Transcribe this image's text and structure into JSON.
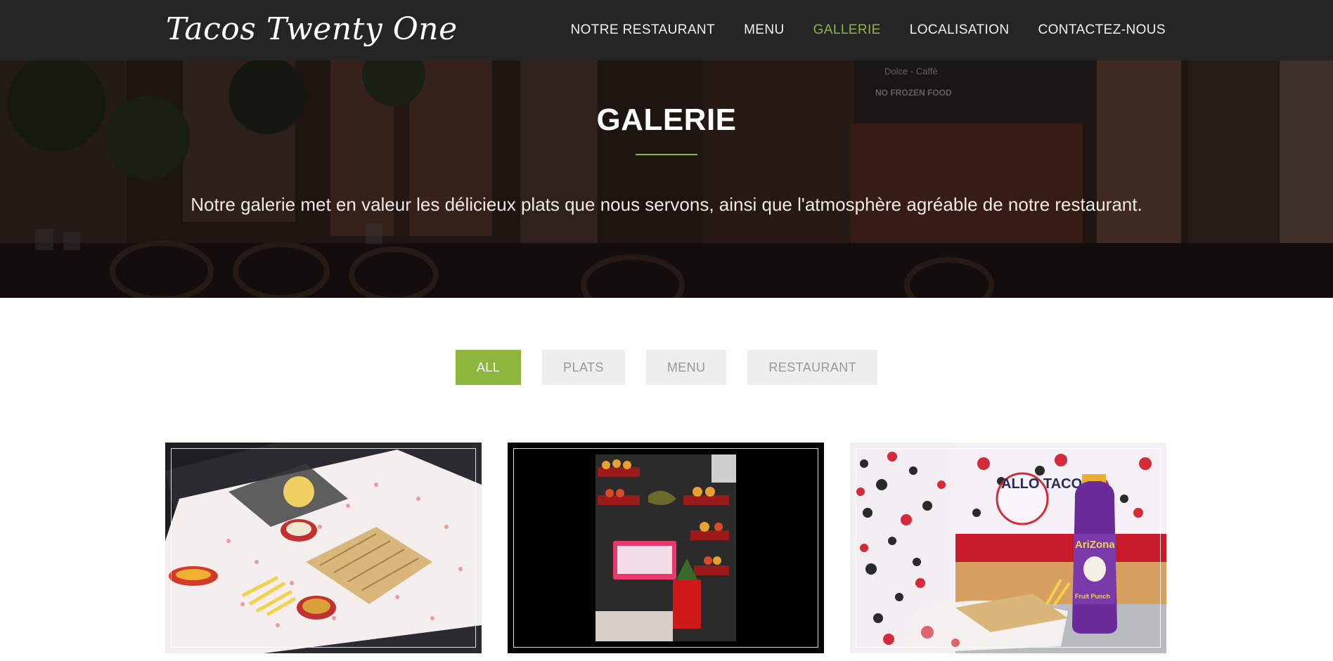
{
  "brand": "Tacos Twenty One",
  "nav": {
    "items": [
      {
        "label": "NOTRE RESTAURANT",
        "active": false
      },
      {
        "label": "MENU",
        "active": false
      },
      {
        "label": "GALLERIE",
        "active": true
      },
      {
        "label": "LOCALISATION",
        "active": false
      },
      {
        "label": "CONTACTEZ-NOUS",
        "active": false
      }
    ]
  },
  "hero": {
    "title": "GALERIE",
    "text": "Notre galerie met en valeur les délicieux plats que nous servons, ainsi que l'atmosphère agréable de notre restaurant.",
    "sign_line1": "Dolce - Caffè",
    "sign_line2": "NO FROZEN FOOD"
  },
  "filters": [
    {
      "label": "ALL",
      "active": true
    },
    {
      "label": "PLATS",
      "active": false
    },
    {
      "label": "MENU",
      "active": false
    },
    {
      "label": "RESTAURANT",
      "active": false
    }
  ],
  "gallery": {
    "photo3_sign": "ALLO TACOS",
    "photo3_bottle_brand": "AriZona",
    "photo3_bottle_flavor": "Fruit Punch"
  },
  "colors": {
    "accent": "#8db63c",
    "navbar": "#252525",
    "filter_bg": "#eeeeee",
    "filter_text": "#999999"
  }
}
